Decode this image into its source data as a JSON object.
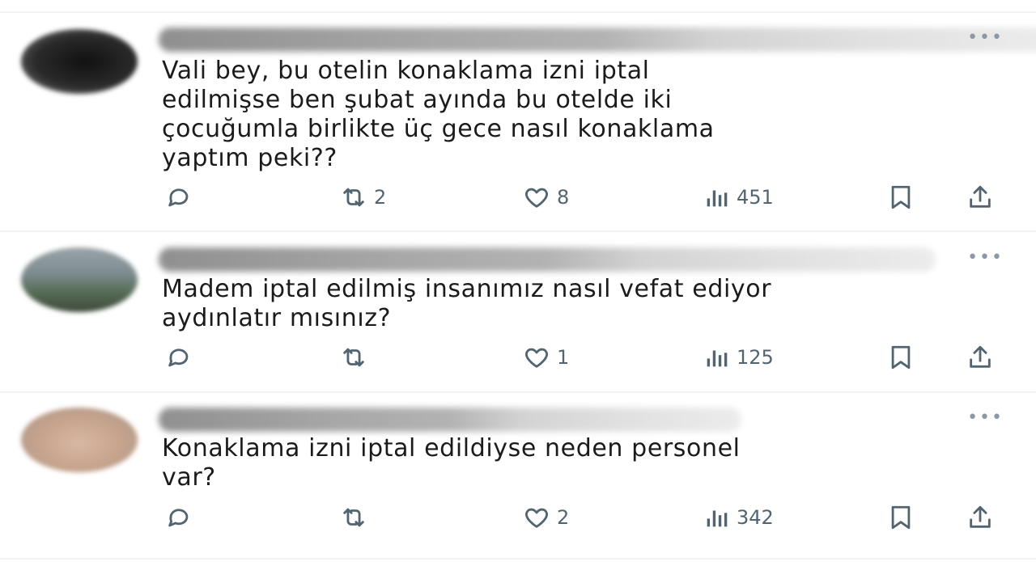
{
  "tweets": [
    {
      "text": "Vali bey, bu otelin konaklama izni iptal\nedilmişse ben şubat ayında bu otelde iki\nçocuğumla birlikte üç gece nasıl konaklama\nyaptım peki??",
      "replies": "",
      "retweets": "2",
      "likes": "8",
      "views": "451"
    },
    {
      "text": "Madem iptal edilmiş insanımız nasıl vefat ediyor\naydınlatır mısınız?",
      "replies": "",
      "retweets": "",
      "likes": "1",
      "views": "125"
    },
    {
      "text": "Konaklama izni iptal edildiyse neden personel\nvar?",
      "replies": "",
      "retweets": "",
      "likes": "2",
      "views": "342"
    }
  ],
  "more_glyph": "•••",
  "icons": [
    "reply-icon",
    "retweet-icon",
    "like-icon",
    "views-icon",
    "bookmark-icon",
    "share-icon"
  ],
  "colors": {
    "icon": "#536471",
    "divider": "#eff3f4",
    "text": "#0f1419"
  }
}
